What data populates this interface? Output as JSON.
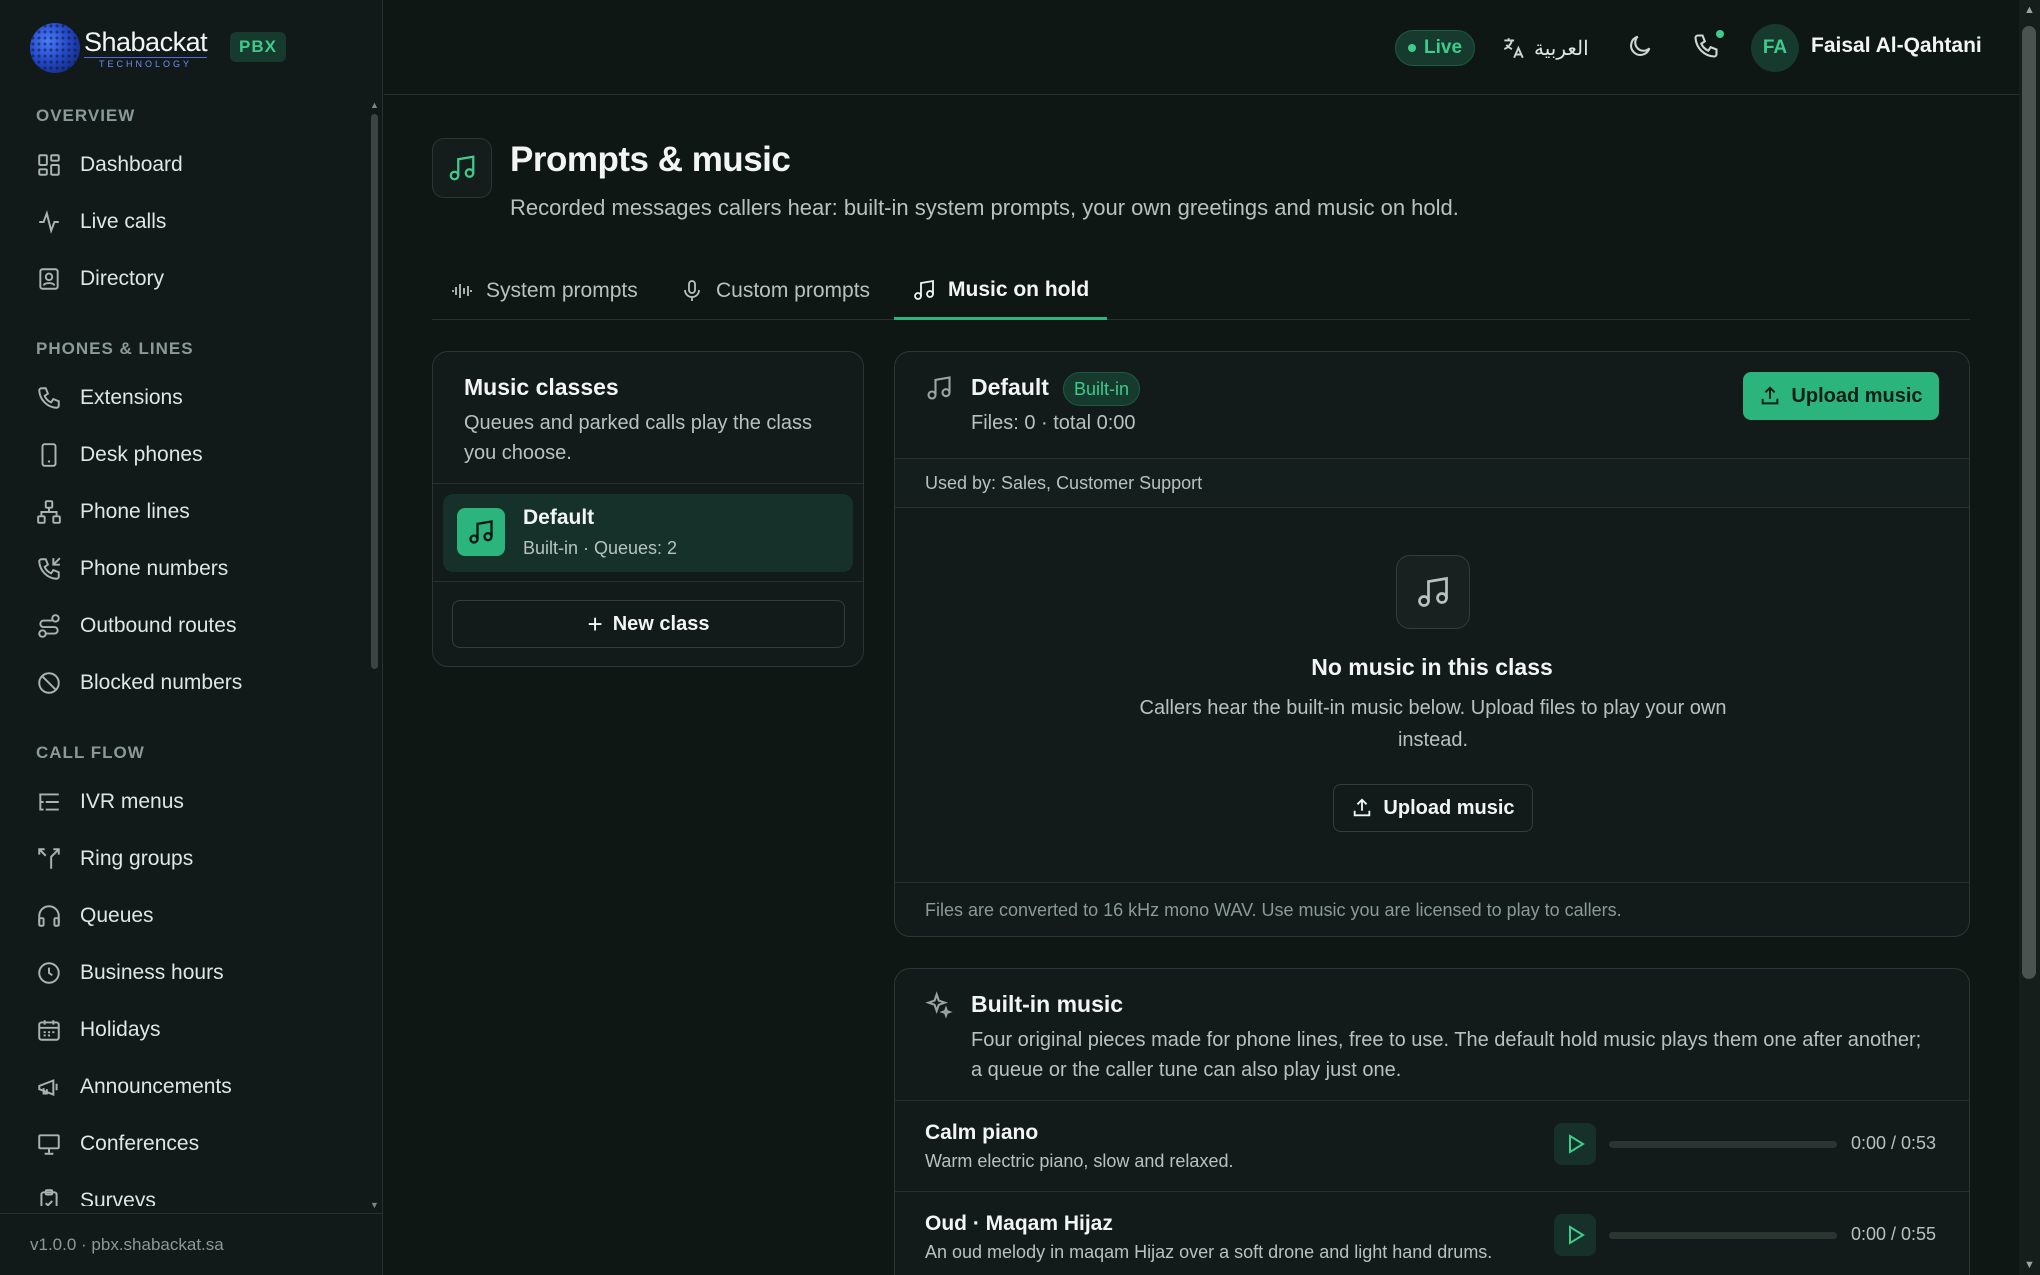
{
  "brand": {
    "name": "Shabackat",
    "tagline": "TECHNOLOGY",
    "badge": "PBX"
  },
  "sidebar": {
    "sections": [
      {
        "title": "OVERVIEW",
        "items": [
          {
            "label": "Dashboard",
            "icon": "dashboard-icon"
          },
          {
            "label": "Live calls",
            "icon": "activity-icon"
          },
          {
            "label": "Directory",
            "icon": "contact-card-icon"
          }
        ]
      },
      {
        "title": "PHONES & LINES",
        "items": [
          {
            "label": "Extensions",
            "icon": "phone-icon"
          },
          {
            "label": "Desk phones",
            "icon": "smartphone-icon"
          },
          {
            "label": "Phone lines",
            "icon": "network-icon"
          },
          {
            "label": "Phone numbers",
            "icon": "phone-incoming-icon"
          },
          {
            "label": "Outbound routes",
            "icon": "route-icon"
          },
          {
            "label": "Blocked numbers",
            "icon": "ban-icon"
          }
        ]
      },
      {
        "title": "CALL FLOW",
        "items": [
          {
            "label": "IVR menus",
            "icon": "list-tree-icon"
          },
          {
            "label": "Ring groups",
            "icon": "split-icon"
          },
          {
            "label": "Queues",
            "icon": "headphones-icon"
          },
          {
            "label": "Business hours",
            "icon": "clock-icon"
          },
          {
            "label": "Holidays",
            "icon": "calendar-icon"
          },
          {
            "label": "Announcements",
            "icon": "megaphone-icon"
          },
          {
            "label": "Conferences",
            "icon": "presentation-icon"
          },
          {
            "label": "Surveys",
            "icon": "clipboard-check-icon"
          }
        ]
      }
    ],
    "footer": "v1.0.0 · pbx.shabackat.sa"
  },
  "topbar": {
    "status": "Live",
    "language": "العربية",
    "user_initials": "FA",
    "user_name": "Faisal Al-Qahtani"
  },
  "page": {
    "title": "Prompts & music",
    "subtitle": "Recorded messages callers hear: built-in system prompts, your own greetings and music on hold."
  },
  "tabs": [
    {
      "label": "System prompts",
      "active": false
    },
    {
      "label": "Custom prompts",
      "active": false
    },
    {
      "label": "Music on hold",
      "active": true
    }
  ],
  "classes_panel": {
    "title": "Music classes",
    "subtitle": "Queues and parked calls play the class you choose.",
    "items": [
      {
        "name": "Default",
        "meta": "Built-in · Queues: 2",
        "selected": true
      }
    ],
    "new_label": "New class"
  },
  "class_detail": {
    "name": "Default",
    "badge": "Built-in",
    "files": "Files: 0 · total 0:00",
    "upload_label": "Upload music",
    "used_by": "Used by: Sales, Customer Support",
    "empty_title": "No music in this class",
    "empty_text": "Callers hear the built-in music below. Upload files to play your own instead.",
    "empty_upload_label": "Upload music",
    "footer": "Files are converted to 16 kHz mono WAV. Use music you are licensed to play to callers."
  },
  "builtin": {
    "title": "Built-in music",
    "subtitle": "Four original pieces made for phone lines, free to use. The default hold music plays them one after another; a queue or the caller tune can also play just one.",
    "tracks": [
      {
        "name": "Calm piano",
        "desc": "Warm electric piano, slow and relaxed.",
        "time": "0:00 / 0:53",
        "progress": 0
      },
      {
        "name": "Oud · Maqam Hijaz",
        "desc": "An oud melody in maqam Hijaz over a soft drone and light hand drums.",
        "time": "0:00 / 0:55",
        "progress": 0
      }
    ]
  },
  "colors": {
    "accent": "#2bb57c",
    "accent_text": "#3ecb8c",
    "background": "#0f1715"
  }
}
